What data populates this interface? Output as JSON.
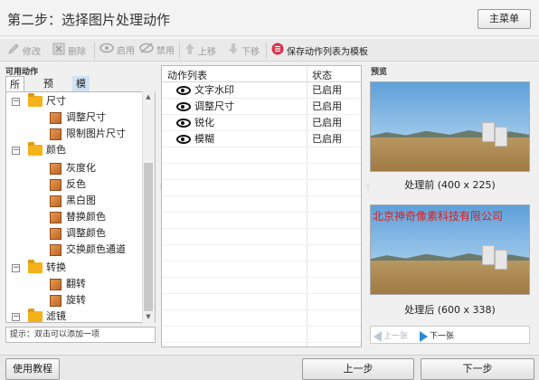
{
  "header": {
    "title": "第二步：选择图片处理动作",
    "main_menu_label": "主菜单"
  },
  "toolbar": {
    "edit_label": "修改",
    "delete_label": "删除",
    "enable_label": "启用",
    "disable_label": "禁用",
    "move_up_label": "上移",
    "move_down_label": "下移",
    "save_template_label": "保存动作列表为模板",
    "colors": {
      "disabled_text": "#9a9a9a",
      "save_icon": "#d9334b"
    }
  },
  "left_panel": {
    "title": "可用动作",
    "tabs": [
      {
        "label": "所有"
      },
      {
        "label": "预设"
      },
      {
        "label": "模板"
      }
    ],
    "tree": [
      {
        "label": "尺寸",
        "type": "folder"
      },
      {
        "label": "调整尺寸",
        "type": "action"
      },
      {
        "label": "限制图片尺寸",
        "type": "action"
      },
      {
        "label": "颜色",
        "type": "folder"
      },
      {
        "label": "灰度化",
        "type": "action"
      },
      {
        "label": "反色",
        "type": "action"
      },
      {
        "label": "黑白图",
        "type": "action"
      },
      {
        "label": "替换颜色",
        "type": "action"
      },
      {
        "label": "调整颜色",
        "type": "action"
      },
      {
        "label": "交换颜色通道",
        "type": "action"
      },
      {
        "label": "转换",
        "type": "folder"
      },
      {
        "label": "翻转",
        "type": "action"
      },
      {
        "label": "旋转",
        "type": "action"
      },
      {
        "label": "滤镜",
        "type": "folder"
      }
    ],
    "hint": "提示：双击可以添加一项"
  },
  "action_list": {
    "col_name": "动作列表",
    "col_status": "状态",
    "rows": [
      {
        "name": "文字水印",
        "status": "已启用"
      },
      {
        "name": "调整尺寸",
        "status": "已启用"
      },
      {
        "name": "锐化",
        "status": "已启用"
      },
      {
        "name": "模糊",
        "status": "已启用"
      }
    ]
  },
  "preview": {
    "title": "预览",
    "before_caption": "处理前 (400 x 225)",
    "after_caption": "处理后 (600 x 338)",
    "watermark_text": "北京神奇像素科技有限公司",
    "prev_label": "上一张",
    "next_label": "下一张",
    "colors": {
      "watermark": "#d82020",
      "next_arrow": "#2a8ad8"
    }
  },
  "footer": {
    "tutorial_label": "使用教程",
    "prev_step_label": "上一步",
    "next_step_label": "下一步"
  }
}
